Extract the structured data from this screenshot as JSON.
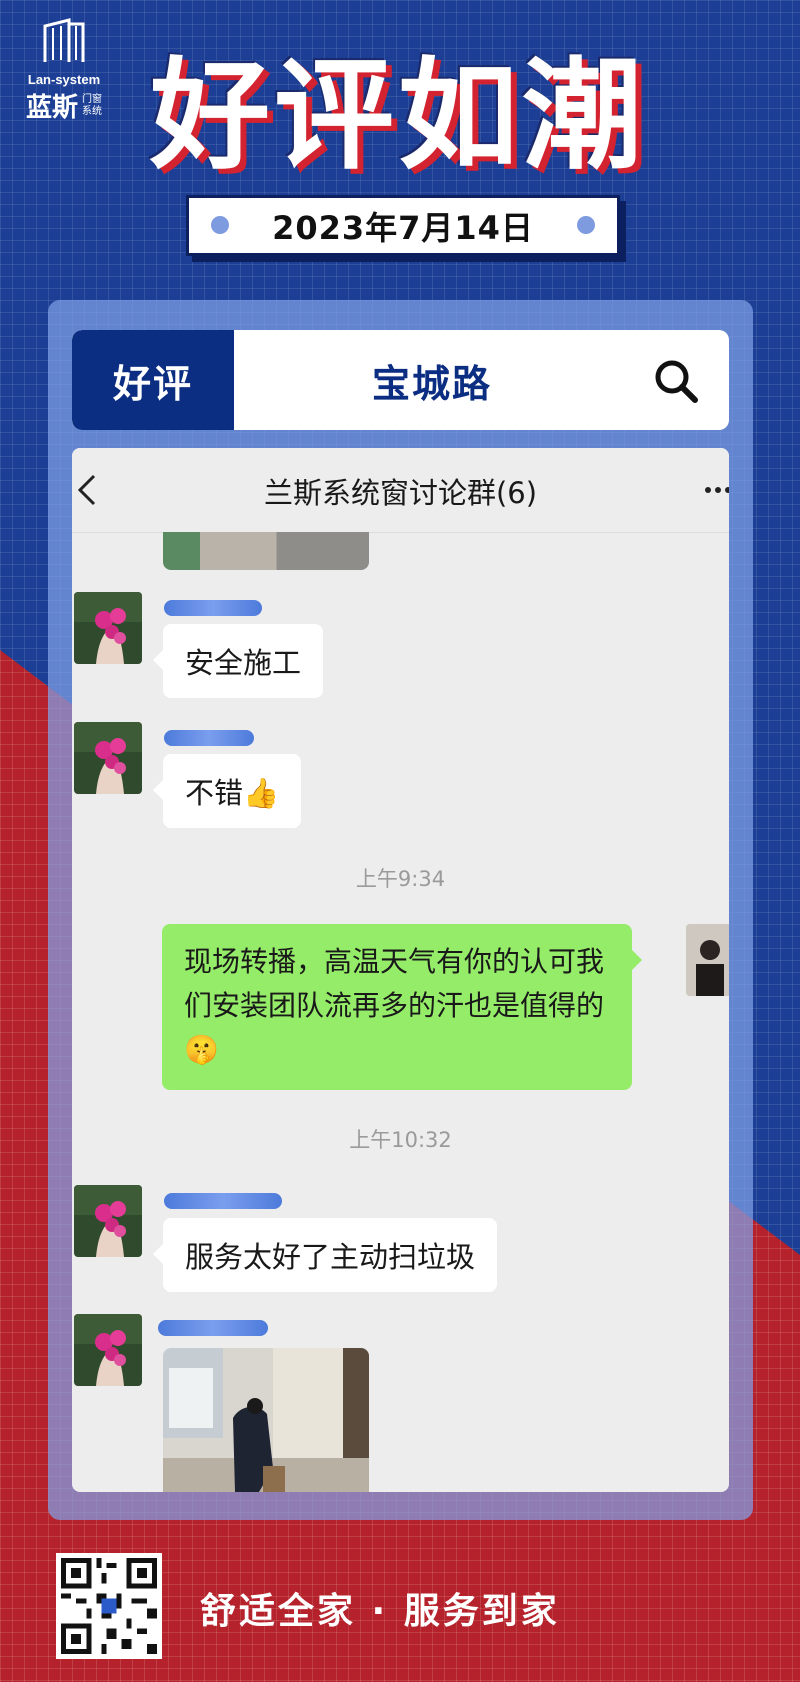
{
  "brand": {
    "name_en": "Lan-system",
    "name_cn": "蓝斯",
    "sub_cn_1": "门窗",
    "sub_cn_2": "系统"
  },
  "headline": "好评如潮",
  "date": "2023年7月14日",
  "tabbar": {
    "tab_review": "好评",
    "tab_location": "宝城路",
    "search_icon": "search-icon"
  },
  "chat": {
    "title": "兰斯系统窗讨论群(6)",
    "messages": [
      {
        "type": "text",
        "text": "安全施工"
      },
      {
        "type": "text",
        "text": "不错👍"
      },
      {
        "type": "time",
        "text": "上午9:34"
      },
      {
        "type": "text_self",
        "text_line1": "现场转播，高温天气有你的认可我",
        "text_line2": "们安装团队流再多的汗也是值得的",
        "emoji": "🤫"
      },
      {
        "type": "time",
        "text": "上午10:32"
      },
      {
        "type": "text",
        "text": "服务太好了主动扫垃圾"
      }
    ]
  },
  "footer": {
    "slogan": "舒适全家 · 服务到家"
  },
  "colors": {
    "navy": "#0b2d82",
    "red": "#b5222b",
    "bubble_green": "#95ec69"
  }
}
